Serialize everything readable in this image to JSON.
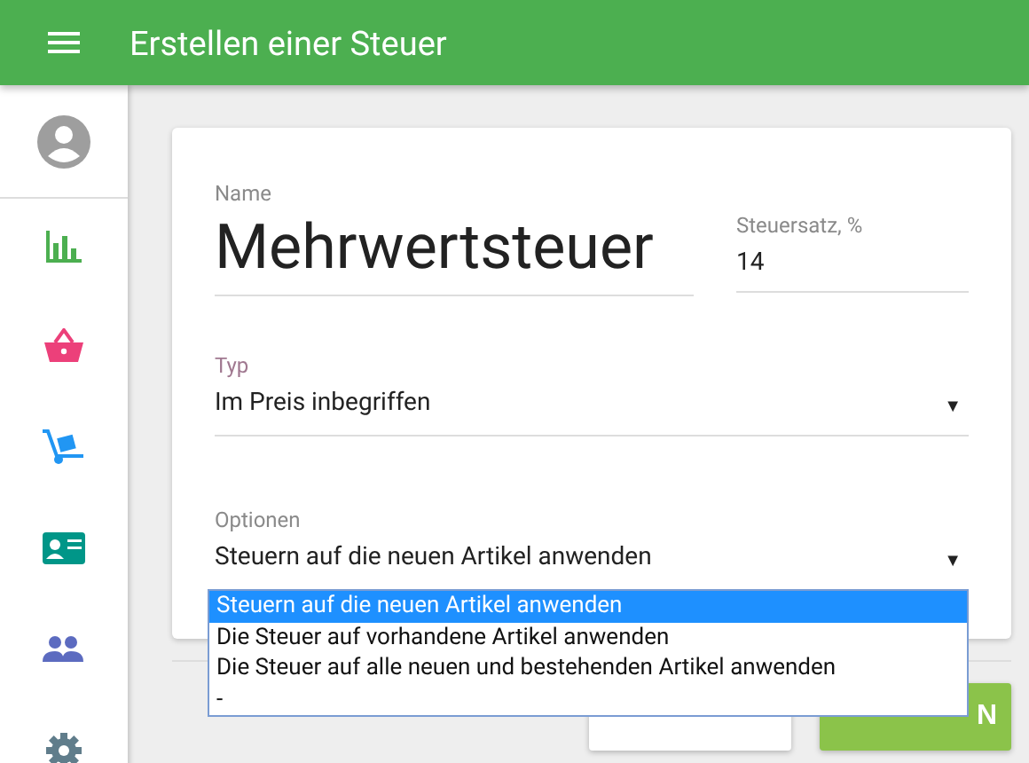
{
  "app_bar": {
    "title": "Erstellen einer Steuer"
  },
  "sidebar": {
    "items": [
      {
        "kind": "chart"
      },
      {
        "kind": "basket"
      },
      {
        "kind": "cart"
      },
      {
        "kind": "card"
      },
      {
        "kind": "people"
      },
      {
        "kind": "gear"
      }
    ]
  },
  "form": {
    "name": {
      "label": "Name",
      "value": "Mehrwertsteuer"
    },
    "rate": {
      "label": "Steuersatz, %",
      "value": "14"
    },
    "type": {
      "label": "Typ",
      "value": "Im Preis inbegriffen",
      "arrow": "▼"
    },
    "options": {
      "label": "Optionen",
      "value": "Steuern auf die neuen Artikel anwenden",
      "arrow": "▼",
      "list": [
        {
          "label": "Steuern auf die neuen Artikel anwenden",
          "selected": true
        },
        {
          "label": "Die Steuer auf vorhandene Artikel anwenden",
          "selected": false
        },
        {
          "label": "Die Steuer auf alle neuen und bestehenden Artikel anwenden",
          "selected": false
        },
        {
          "label": "-",
          "selected": false
        }
      ]
    }
  },
  "buttons": [
    {
      "kind": "plain"
    },
    {
      "kind": "primary",
      "label": "N"
    }
  ]
}
